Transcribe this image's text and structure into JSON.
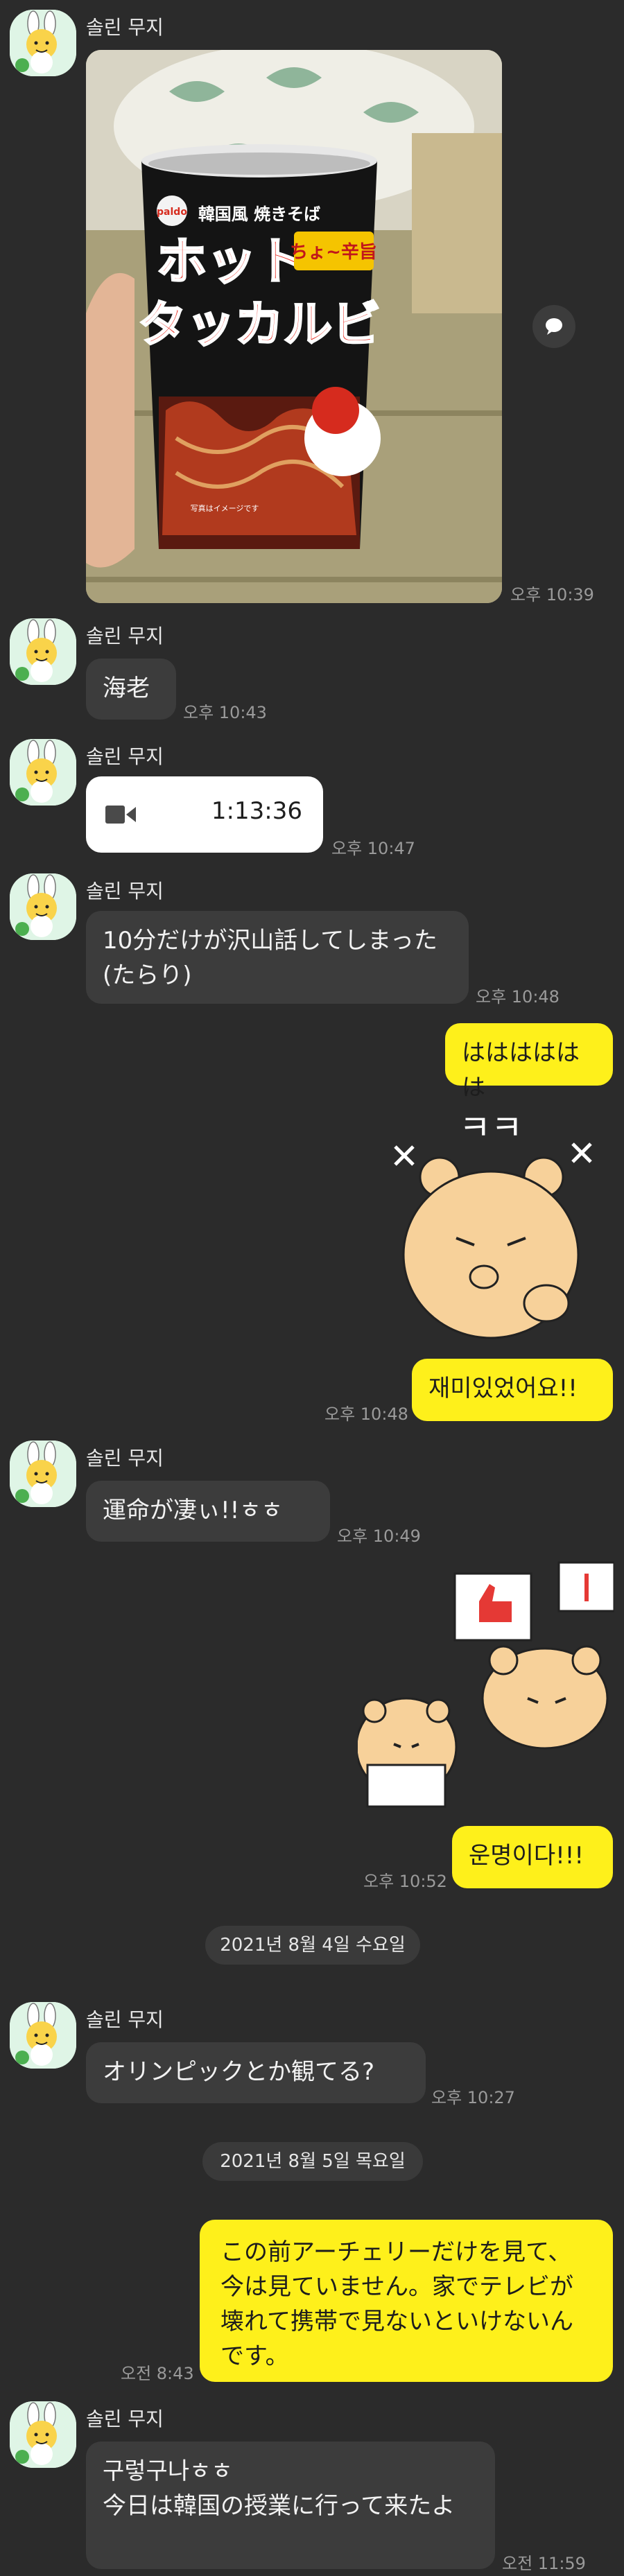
{
  "chat": {
    "sender": "솔린 무지",
    "messages": {
      "m1_time": "오후 10:39",
      "m2_text": "海老",
      "m2_time": "오후 10:43",
      "m3_duration": "1:13:36",
      "m3_time": "오후 10:47",
      "m4_text": "10分だけが沢山話してしまった(たらり)",
      "m4_time": "오후 10:48",
      "m5_text": "はははははは",
      "m6_text": "재미있었어요!!",
      "m6_time": "오후 10:48",
      "m7_text": "運命が凄ぃ!!ㅎㅎ",
      "m7_time": "오후 10:49",
      "m8_text": "운명이다!!!",
      "m8_time": "오후 10:52",
      "date1": "2021년 8월 4일 수요일",
      "m9_text": "オリンピックとか観てる?",
      "m9_time": "오후 10:27",
      "date2": "2021년 8월 5일 목요일",
      "m10_text": "この前アーチェリーだけを見て、今は見ていません。家でテレビが壊れて携帯で見ないといけないんです。",
      "m10_time": "오전 8:43",
      "m11_line1": "구렇구나ㅎㅎ",
      "m11_line2": "今日は韓国の授業に行って来たよ",
      "m11_time": "오전 11:59"
    }
  },
  "photo": {
    "brand": "paldo",
    "subtitle": "韓国風 焼きそば",
    "line1": "ホット",
    "line2": "タッカルビ",
    "badge": "ちょ~辛旨",
    "note": "写真はイメージです"
  },
  "stickers": {
    "bear1_text": "ㅋㅋ"
  },
  "colors": {
    "background": "#2b2b2b",
    "incoming": "#3c3c3c",
    "outgoing": "#fef01b"
  }
}
